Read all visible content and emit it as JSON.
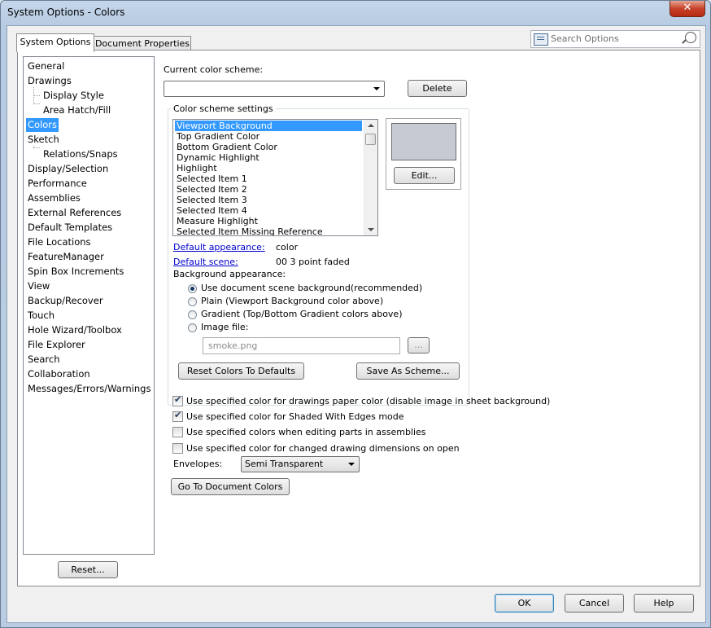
{
  "window": {
    "title": "System Options - Colors",
    "close_label": "✕"
  },
  "tabs": [
    {
      "label": "System Options"
    },
    {
      "label": "Document Properties"
    }
  ],
  "search": {
    "placeholder": "Search Options"
  },
  "tree": {
    "items": [
      {
        "label": "General"
      },
      {
        "label": "Drawings"
      },
      {
        "label": "Display Style"
      },
      {
        "label": "Area Hatch/Fill"
      },
      {
        "label": "Colors"
      },
      {
        "label": "Sketch"
      },
      {
        "label": "Relations/Snaps"
      },
      {
        "label": "Display/Selection"
      },
      {
        "label": "Performance"
      },
      {
        "label": "Assemblies"
      },
      {
        "label": "External References"
      },
      {
        "label": "Default Templates"
      },
      {
        "label": "File Locations"
      },
      {
        "label": "FeatureManager"
      },
      {
        "label": "Spin Box Increments"
      },
      {
        "label": "View"
      },
      {
        "label": "Backup/Recover"
      },
      {
        "label": "Touch"
      },
      {
        "label": "Hole Wizard/Toolbox"
      },
      {
        "label": "File Explorer"
      },
      {
        "label": "Search"
      },
      {
        "label": "Collaboration"
      },
      {
        "label": "Messages/Errors/Warnings"
      }
    ],
    "selected": "Colors"
  },
  "reset_label": "Reset...",
  "scheme": {
    "label": "Current color scheme:",
    "value": "",
    "delete_label": "Delete"
  },
  "settings": {
    "group_label": "Color scheme settings",
    "items": [
      {
        "label": "Viewport Background"
      },
      {
        "label": "Top Gradient Color"
      },
      {
        "label": "Bottom Gradient Color"
      },
      {
        "label": "Dynamic Highlight"
      },
      {
        "label": "Highlight"
      },
      {
        "label": "Selected Item 1"
      },
      {
        "label": "Selected Item 2"
      },
      {
        "label": "Selected Item 3"
      },
      {
        "label": "Selected Item 4"
      },
      {
        "label": "Measure Highlight"
      },
      {
        "label": "Selected Item Missing Reference"
      }
    ],
    "selected": "Viewport Background",
    "swatch_color": "#c6cbd3",
    "edit_label": "Edit...",
    "default_appearance_label": "Default appearance:",
    "default_appearance_value": "color",
    "default_scene_label": "Default scene:",
    "default_scene_value": "00 3 point faded",
    "background_label": "Background appearance:",
    "background_options": [
      {
        "label": "Use document scene background(recommended)",
        "checked": true
      },
      {
        "label": "Plain (Viewport Background color above)",
        "checked": false
      },
      {
        "label": "Gradient (Top/Bottom Gradient colors above)",
        "checked": false
      },
      {
        "label": "Image file:",
        "checked": false
      }
    ],
    "image_file": "smoke.png",
    "browse_label": "...",
    "reset_colors_label": "Reset Colors To Defaults",
    "save_scheme_label": "Save As Scheme..."
  },
  "checkboxes": [
    {
      "label": "Use specified color for drawings paper color (disable image in sheet background)",
      "checked": true
    },
    {
      "label": "Use specified color for Shaded With Edges mode",
      "checked": true
    },
    {
      "label": "Use specified colors when editing parts in assemblies",
      "checked": false
    },
    {
      "label": "Use specified color for changed drawing dimensions on open",
      "checked": false
    }
  ],
  "envelopes": {
    "label": "Envelopes:",
    "value": "Semi Transparent"
  },
  "go_to_doc_colors_label": "Go To Document Colors",
  "footer": {
    "ok": "OK",
    "cancel": "Cancel",
    "help": "Help"
  },
  "colors": {
    "selection": "#3399ff",
    "link": "#0000cc",
    "close": "#c7412a"
  }
}
